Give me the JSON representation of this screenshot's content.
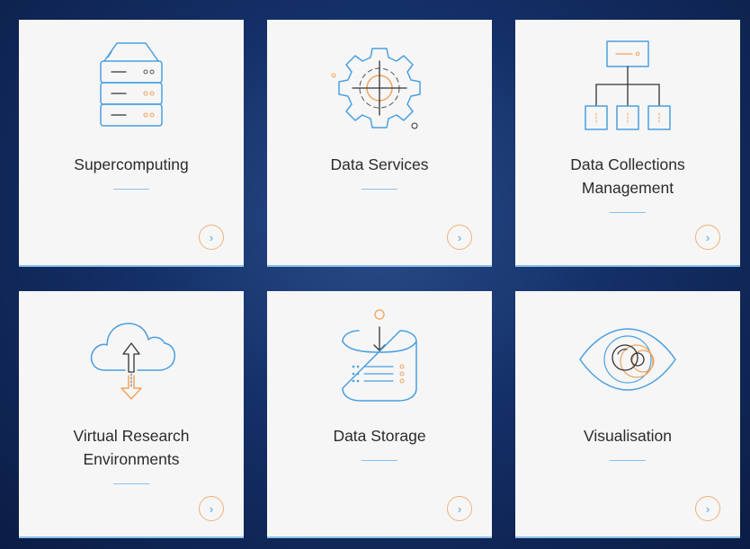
{
  "cards": [
    {
      "title": "Supercomputing",
      "icon": "server-rack-icon"
    },
    {
      "title": "Data Services",
      "icon": "gear-target-icon"
    },
    {
      "title": "Data Collections Management",
      "icon": "hierarchy-chart-icon"
    },
    {
      "title": "Virtual Research Environments",
      "icon": "cloud-transfer-icon"
    },
    {
      "title": "Data Storage",
      "icon": "storage-drive-icon"
    },
    {
      "title": "Visualisation",
      "icon": "eye-icon"
    }
  ],
  "arrow_glyph": "›",
  "colors": {
    "blue": "#4a9fe0",
    "orange": "#f0a35e",
    "card": "#f6f6f6",
    "rule": "#8cc0ea"
  }
}
